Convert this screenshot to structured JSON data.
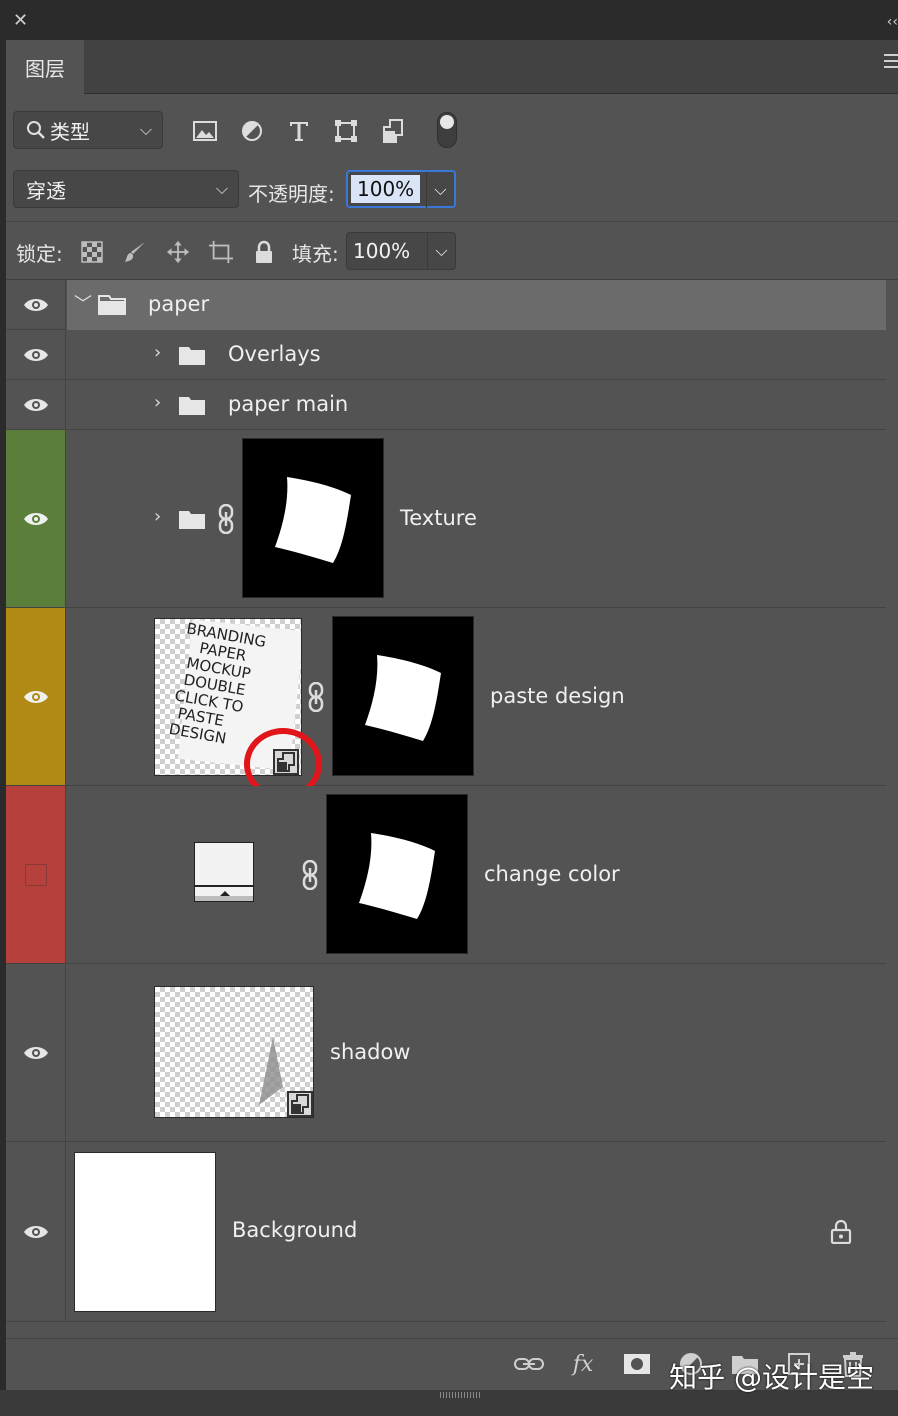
{
  "panel": {
    "tab_label": "图层"
  },
  "filter": {
    "kind_label": "类型"
  },
  "blend": {
    "mode": "穿透",
    "opacity_label": "不透明度:",
    "opacity_value": "100%"
  },
  "lock": {
    "label": "锁定:",
    "fill_label": "填充:",
    "fill_value": "100%"
  },
  "layers": [
    {
      "name": "paper",
      "type": "group",
      "expanded": true,
      "selected": true,
      "visible": true
    },
    {
      "name": "Overlays",
      "type": "group",
      "expanded": false,
      "visible": true
    },
    {
      "name": "paper main",
      "type": "group",
      "expanded": false,
      "visible": true
    },
    {
      "name": "Texture",
      "type": "group",
      "expanded": false,
      "visible": true,
      "color": "#5b7f3a"
    },
    {
      "name": "paste design",
      "type": "smart-object",
      "visible": true,
      "color": "#b08a14",
      "thumb_text": [
        "BRANDING",
        "PAPER",
        "MOCKUP",
        "DOUBLE",
        "CLICK TO",
        "PASTE",
        "DESIGN"
      ]
    },
    {
      "name": "change color",
      "type": "fill",
      "visible": false,
      "color": "#b5403c"
    },
    {
      "name": "shadow",
      "type": "smart-object",
      "visible": true
    },
    {
      "name": "Background",
      "type": "background",
      "visible": true,
      "locked": true
    }
  ],
  "watermark": "知乎 @设计是空",
  "colors": {
    "panel_bg": "#535353",
    "selected_row": "#6b6b6b",
    "texture_label": "#5b7f3a",
    "paste_label": "#b08a14",
    "change_label": "#b5403c",
    "highlight_circle": "#e0161b",
    "focus_blue": "#3a78d8"
  }
}
